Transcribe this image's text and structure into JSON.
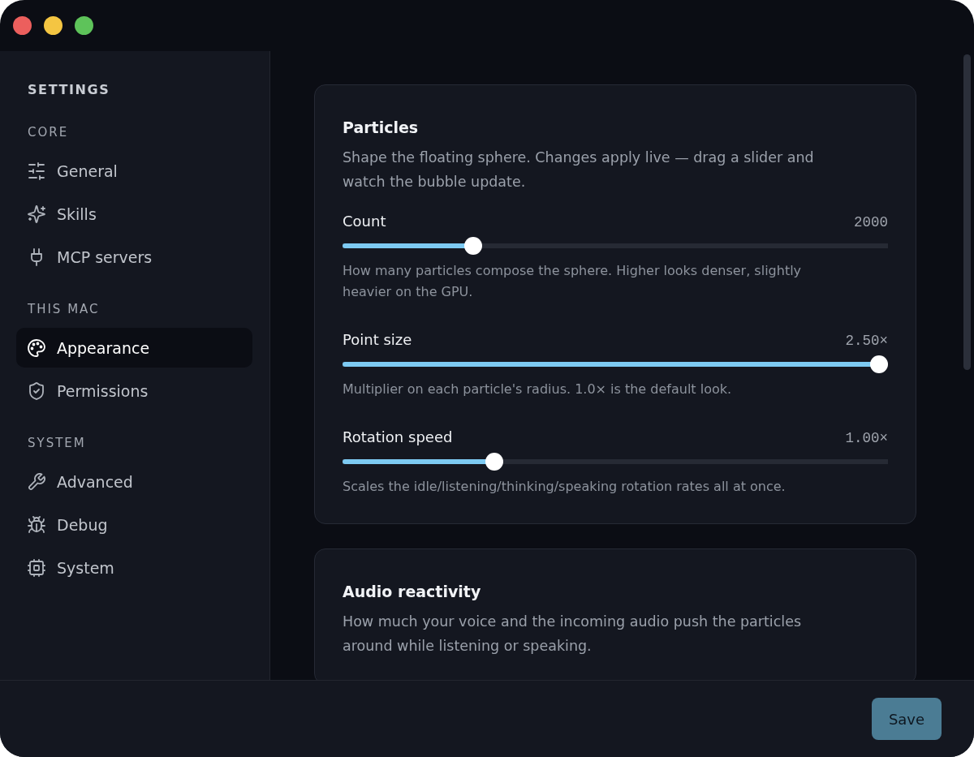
{
  "sidebar": {
    "heading": "SETTINGS",
    "groups": [
      {
        "label": "CORE",
        "items": [
          {
            "label": "General",
            "selected": false
          },
          {
            "label": "Skills",
            "selected": false
          },
          {
            "label": "MCP servers",
            "selected": false
          }
        ]
      },
      {
        "label": "THIS MAC",
        "items": [
          {
            "label": "Appearance",
            "selected": true
          },
          {
            "label": "Permissions",
            "selected": false
          }
        ]
      },
      {
        "label": "SYSTEM",
        "items": [
          {
            "label": "Advanced",
            "selected": false
          },
          {
            "label": "Debug",
            "selected": false
          },
          {
            "label": "System",
            "selected": false
          }
        ]
      }
    ]
  },
  "sections": [
    {
      "title": "Particles",
      "description": "Shape the floating sphere. Changes apply live — drag a slider and watch the bubble update.",
      "sliders": [
        {
          "label": "Count",
          "value": "2000",
          "level": 0.23,
          "help": "How many particles compose the sphere. Higher looks denser, slightly heavier on the GPU."
        },
        {
          "label": "Point size",
          "value": "2.50×",
          "level": 1.0,
          "help": "Multiplier on each particle's radius. 1.0× is the default look."
        },
        {
          "label": "Rotation speed",
          "value": "1.00×",
          "level": 0.27,
          "help": "Scales the idle/listening/thinking/speaking rotation rates all at once."
        }
      ]
    },
    {
      "title": "Audio reactivity",
      "description": "How much your voice and the incoming audio push the particles around while listening or speaking."
    }
  ],
  "footer": {
    "save_button": "Save"
  }
}
